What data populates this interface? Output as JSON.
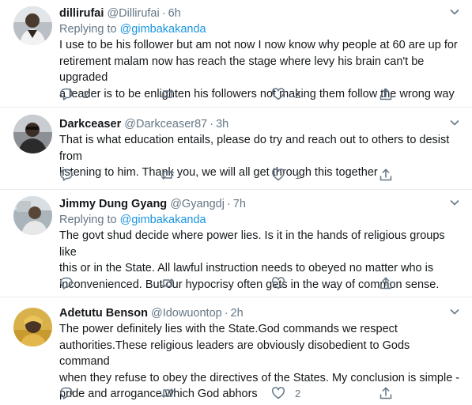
{
  "tweets": [
    {
      "name": "dillirufai",
      "handle": "@Dillirufai",
      "time": "6h",
      "reply_prefix": "Replying to",
      "reply_to": "@gimbakakanda",
      "lines": [
        "I use to be his follower but am not now I now know why people at 60 are up for",
        "retirement malam now has reach the stage where levy his brain can't be upgraded",
        "a leader is to be enlighten his followers not making them follow the wrong way"
      ],
      "replies": "2",
      "retweets": "",
      "likes": "2"
    },
    {
      "name": "Darkceaser",
      "handle": "@Darkceaser87",
      "time": "3h",
      "lines": [
        "That is what education entails, please do try and reach out to others to desist from",
        "listening to him. Thank you, we will all get through this together"
      ],
      "replies": "",
      "retweets": "",
      "likes": "1"
    },
    {
      "name": "Jimmy Dung Gyang",
      "handle": "@Gyangdj",
      "time": "7h",
      "reply_prefix": "Replying to",
      "reply_to": "@gimbakakanda",
      "lines": [
        "The govt shud decide where power lies. Is it in the hands of religious groups like",
        "this or in the State. All lawful instruction needs to obeyed no matter who is",
        "inconvenienced. But our hypocrisy often gets in the way of common sense."
      ],
      "replies": "",
      "retweets": "",
      "likes": ""
    },
    {
      "name": "Adetutu Benson",
      "handle": "@Idowuontop",
      "time": "2h",
      "lines": [
        "The power definitely lies with the State.God commands we respect",
        "authorities.These religious  leaders  are obviously disobedient to Gods command",
        "when they refuse to obey the directives of the States. My conclusion is simple -",
        "pride and arrogance which God abhors"
      ],
      "replies": "",
      "retweets": "",
      "likes": "2"
    }
  ],
  "icons": {
    "reply": "reply-icon",
    "retweet": "retweet-icon",
    "like": "heart-icon",
    "share": "share-icon",
    "menu": "chevron-down-icon"
  },
  "colors": {
    "text": "#14171a",
    "muted": "#657786",
    "link": "#1b95e0",
    "divider": "#e6ecf0"
  }
}
